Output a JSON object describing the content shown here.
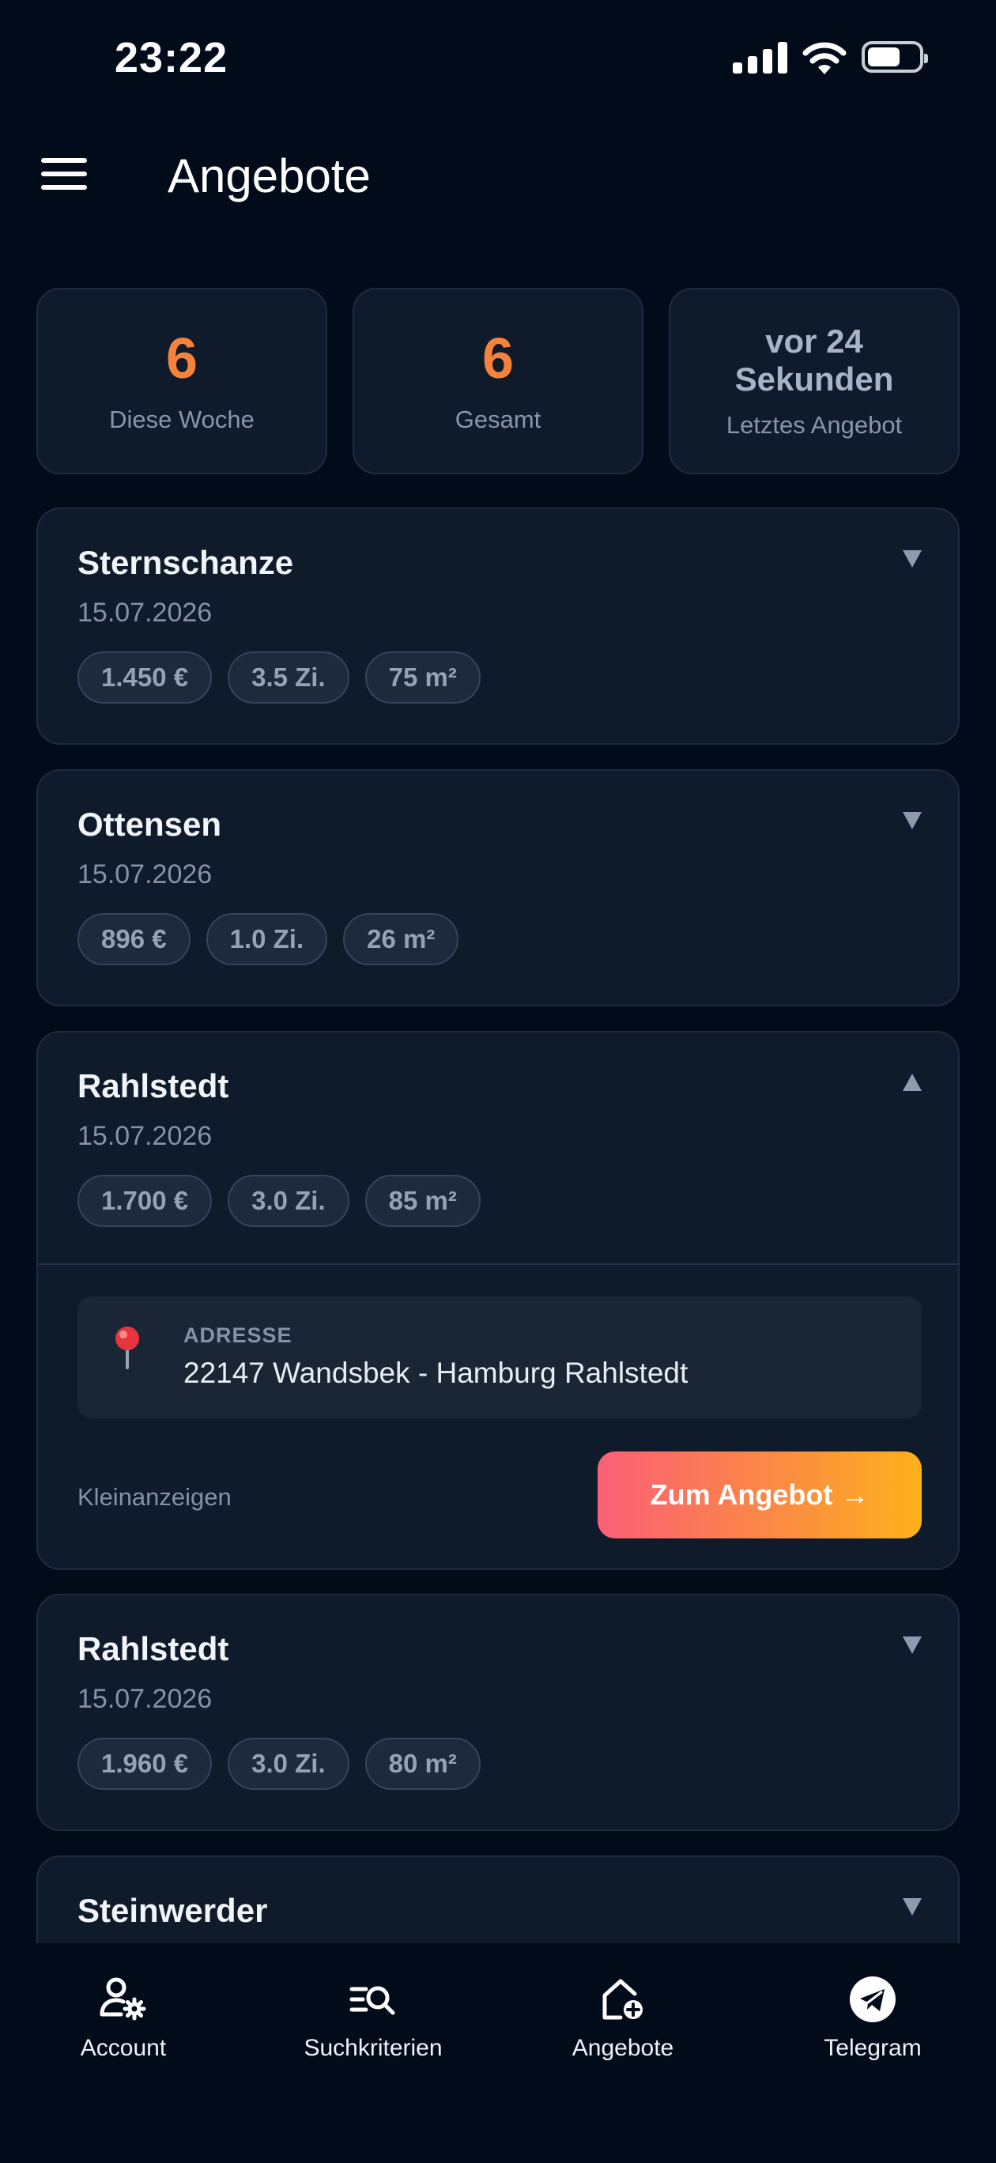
{
  "status_bar": {
    "time": "23:22",
    "icons": [
      "signal-icon",
      "wifi-icon",
      "battery-icon"
    ]
  },
  "header": {
    "title": "Angebote",
    "menu_icon": "hamburger-menu-icon"
  },
  "stats": [
    {
      "value": "6",
      "label": "Diese Woche"
    },
    {
      "value": "6",
      "label": "Gesamt"
    },
    {
      "value": "vor 24 Sekunden",
      "label": "Letztes Angebot"
    }
  ],
  "listings": [
    {
      "title": "Sternschanze",
      "date": "15.07.2026",
      "price": "1.450 €",
      "rooms": "3.5 Zi.",
      "area": "75 m²",
      "expanded": false
    },
    {
      "title": "Ottensen",
      "date": "15.07.2026",
      "price": "896 €",
      "rooms": "1.0 Zi.",
      "area": "26 m²",
      "expanded": false
    },
    {
      "title": "Rahlstedt",
      "date": "15.07.2026",
      "price": "1.700 €",
      "rooms": "3.0 Zi.",
      "area": "85 m²",
      "expanded": true,
      "address_label": "ADRESSE",
      "address": "22147 Wandsbek - Hamburg Rahlstedt",
      "source": "Kleinanzeigen",
      "cta": "Zum Angebot →"
    },
    {
      "title": "Rahlstedt",
      "date": "15.07.2026",
      "price": "1.960 €",
      "rooms": "3.0 Zi.",
      "area": "80 m²",
      "expanded": false
    },
    {
      "title": "Steinwerder",
      "expanded": false
    }
  ],
  "nav": [
    {
      "label": "Account",
      "icon": "account-settings-icon"
    },
    {
      "label": "Suchkriterien",
      "icon": "search-criteria-icon"
    },
    {
      "label": "Angebote",
      "icon": "home-add-icon"
    },
    {
      "label": "Telegram",
      "icon": "telegram-icon"
    }
  ],
  "colors": {
    "background": "#020b1a",
    "card": "#0f1a2b",
    "accent": "#f5823b",
    "cta_start": "#fb5f76",
    "cta_end": "#fcb21a"
  }
}
